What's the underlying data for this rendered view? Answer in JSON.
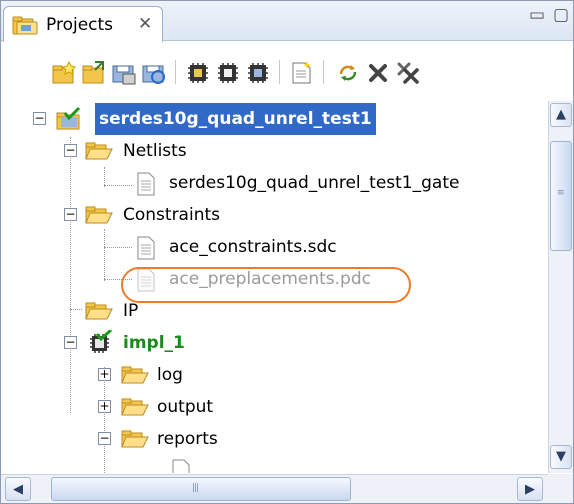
{
  "panel": {
    "tab_label": "Projects",
    "close_glyph": "✕",
    "minimize_glyph": "▭",
    "maximize_glyph": "▢"
  },
  "toolbar": {
    "buttons": [
      {
        "name": "new-project-icon"
      },
      {
        "name": "open-project-icon"
      },
      {
        "name": "save-project-icon"
      },
      {
        "name": "refresh-project-icon"
      },
      {
        "name": "chip-run-icon"
      },
      {
        "name": "chip-flow-icon"
      },
      {
        "name": "chip-save-icon"
      },
      {
        "name": "add-file-icon"
      },
      {
        "name": "sync-icon"
      },
      {
        "name": "delete-icon"
      },
      {
        "name": "delete-all-icon"
      }
    ]
  },
  "tree": {
    "project": "serdes10g_quad_unrel_test1",
    "netlists": "Netlists",
    "netlist_file": "serdes10g_quad_unrel_test1_gate",
    "constraints": "Constraints",
    "sdc_file": "ace_constraints.sdc",
    "pdc_file": "ace_preplacements.pdc",
    "ip": "IP",
    "impl": "impl_1",
    "log": "log",
    "output": "output",
    "reports": "reports"
  },
  "colors": {
    "selection": "#3169c6",
    "impl_text": "#1a8a1a",
    "highlight_ring": "#f07a2a",
    "folder": "#f3c64a"
  }
}
